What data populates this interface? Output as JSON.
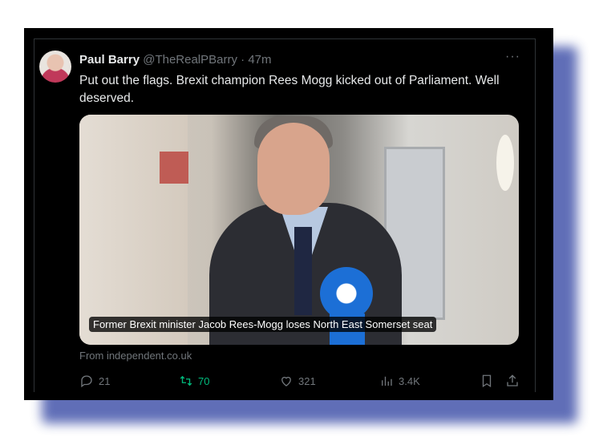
{
  "tweet": {
    "display_name": "Paul Barry",
    "handle": "@TheRealPBarry",
    "separator": "·",
    "time": "47m",
    "more": "···",
    "text": "Put out the flags. Brexit champion Rees Mogg kicked out of Parliament. Well deserved.",
    "media_caption": "Former Brexit minister Jacob Rees-Mogg loses North East Somerset seat",
    "source": "From independent.co.uk"
  },
  "actions": {
    "replies": "21",
    "reposts": "70",
    "likes": "321",
    "views": "3.4K"
  },
  "colors": {
    "background": "#000000",
    "text": "#e7e9ea",
    "muted": "#71767b",
    "repost_active": "#00ba7c",
    "frame_shadow": "#4f5fb0"
  },
  "icons": [
    "reply-icon",
    "repost-icon",
    "like-icon",
    "views-icon",
    "bookmark-icon",
    "share-icon",
    "more-icon"
  ]
}
